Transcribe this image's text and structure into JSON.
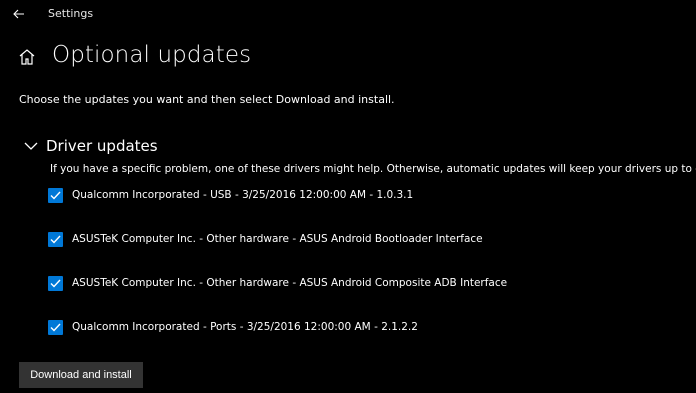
{
  "window": {
    "app_title": "Settings"
  },
  "page": {
    "title": "Optional updates",
    "description": "Choose the updates you want and then select Download and install."
  },
  "section": {
    "title": "Driver updates",
    "description": "If you have a specific problem, one of these drivers might help. Otherwise, automatic updates will keep your drivers up to date."
  },
  "drivers": [
    {
      "label": "Qualcomm Incorporated - USB - 3/25/2016 12:00:00 AM - 1.0.3.1",
      "checked": true
    },
    {
      "label": "ASUSTeK Computer Inc. - Other hardware - ASUS Android Bootloader Interface",
      "checked": true
    },
    {
      "label": "ASUSTeK Computer Inc. - Other hardware - ASUS Android Composite ADB Interface",
      "checked": true
    },
    {
      "label": "Qualcomm Incorporated - Ports - 3/25/2016 12:00:00 AM - 2.1.2.2",
      "checked": true
    }
  ],
  "actions": {
    "download_label": "Download and install"
  },
  "colors": {
    "background": "#000000",
    "accent": "#0078d7",
    "button": "#333333"
  }
}
